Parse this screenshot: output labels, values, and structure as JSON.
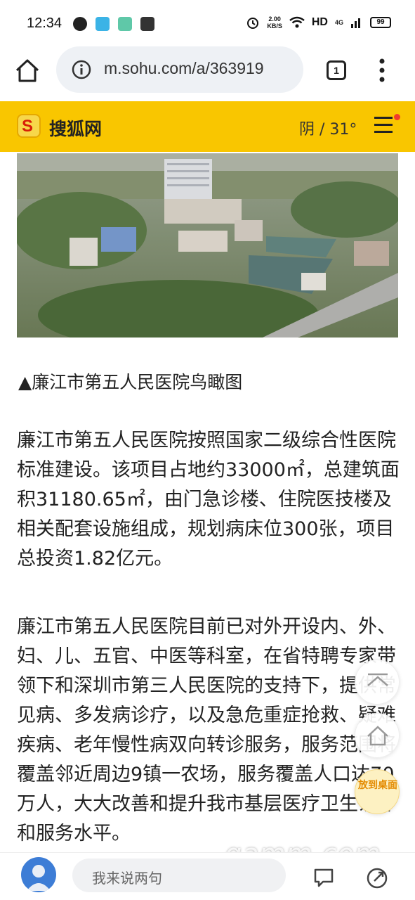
{
  "status_bar": {
    "time": "12:34",
    "net_speed_value": "2.00",
    "net_speed_unit": "KB/S",
    "hd_label": "HD",
    "network_type": "4G",
    "battery": "99"
  },
  "browser": {
    "url": "m.sohu.com/a/363919",
    "tab_count": "1"
  },
  "site_header": {
    "logo_letter": "S",
    "site_name": "搜狐网",
    "weather": "阴 / 31°",
    "brand_color": "#f9c600"
  },
  "article": {
    "image_caption": "▲廉江市第五人民医院鸟瞰图",
    "paragraphs": [
      "廉江市第五人民医院按照国家二级综合性医院标准建设。该项目占地约33000㎡，总建筑面积31180.65㎡，由门急诊楼、住院医技楼及相关配套设施组成，规划病床位300张，项目总投资1.82亿元。",
      "廉江市第五人民医院目前已对外开设内、外、妇、儿、五官、中医等科室，在省特聘专家带领下和深圳市第三人民医院的支持下，提供常见病、多发病诊疗，以及急危重症抢救、疑难疾病、老年慢性病双向转诊服务，服务范围将覆盖邻近周边9镇一农场，服务覆盖人口达70 万人，大大改善和提升我市基层医疗卫生条件和服务水平。"
    ]
  },
  "floating": {
    "desktop_label": "放到桌面"
  },
  "bottom_bar": {
    "comment_placeholder": "我来说两句"
  },
  "watermark": "gamm.com"
}
